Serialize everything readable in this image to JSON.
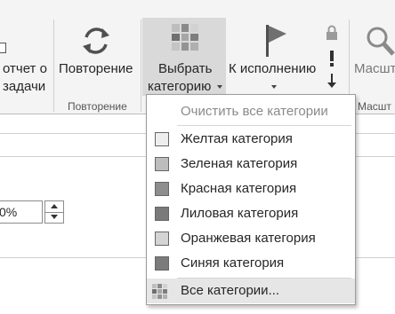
{
  "ribbon": {
    "report_button": {
      "line1": "отчет о",
      "line2": "задачи"
    },
    "recurrence_button": {
      "label": "Повторение"
    },
    "recurrence_group": "Повторение",
    "categorize_button": {
      "line1": "Выбрать",
      "line2": "категорию"
    },
    "follow_up_button": {
      "label": "К исполнению"
    },
    "zoom_button": {
      "label": "Масшт"
    },
    "zoom_group": "Масшт"
  },
  "category_menu": {
    "clear_all": "Очистить все категории",
    "items": [
      {
        "label": "Желтая категория",
        "color": "#eeeeee"
      },
      {
        "label": "Зеленая категория",
        "color": "#bdbdbd"
      },
      {
        "label": "Красная категория",
        "color": "#8d8d8d"
      },
      {
        "label": "Лиловая категория",
        "color": "#7a7a7a"
      },
      {
        "label": "Оранжевая категория",
        "color": "#d4d4d4"
      },
      {
        "label": "Синяя категория",
        "color": "#7b7b7b"
      }
    ],
    "all_categories": "Все категории..."
  },
  "form": {
    "percent_value": "0%"
  },
  "icons": {
    "report": "report-icon",
    "recurrence": "recurrence-icon",
    "categorize": "categorize-icon",
    "follow_up": "flag-icon",
    "private": "lock-icon",
    "importance": "exclamation-icon",
    "low_importance": "down-arrow-icon",
    "zoom": "magnifier-icon"
  }
}
